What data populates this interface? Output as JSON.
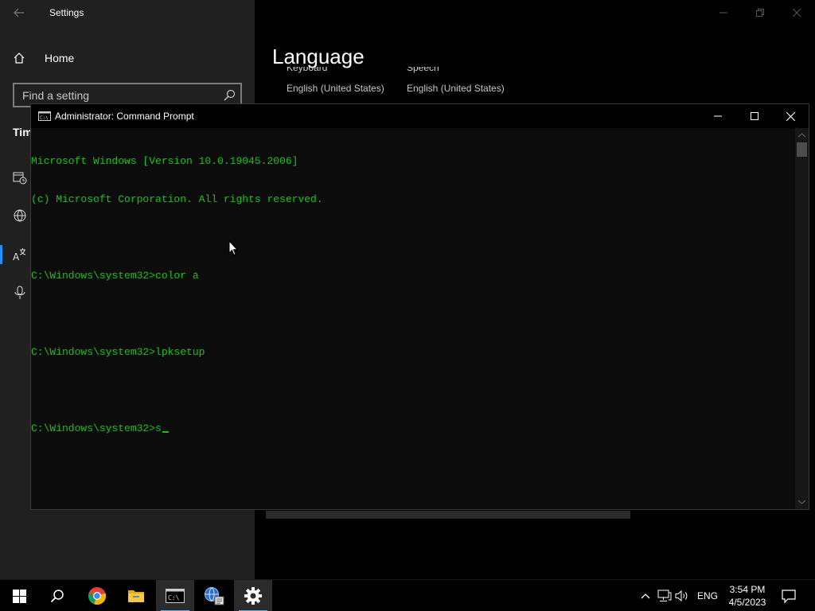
{
  "settings": {
    "window_title": "Settings",
    "home_label": "Home",
    "search_placeholder": "Find a setting",
    "partial_heading": "Tim",
    "page_heading": "Language",
    "columns": [
      {
        "cut_label": "Keyboard",
        "value": "English (United States)"
      },
      {
        "cut_label": "Speech",
        "value": "English (United States)"
      }
    ]
  },
  "cmd": {
    "title": "Administrator: Command Prompt",
    "lines": [
      "Microsoft Windows [Version 10.0.19045.2006]",
      "(c) Microsoft Corporation. All rights reserved.",
      "",
      "C:\\Windows\\system32>color a",
      "",
      "C:\\Windows\\system32>lpksetup",
      "",
      "C:\\Windows\\system32>s"
    ],
    "text_color": "#13c613"
  },
  "taskbar": {
    "apps": [
      "start-icon",
      "search-icon",
      "chrome-icon",
      "file-explorer-icon",
      "command-prompt-icon",
      "network-globe-icon",
      "settings-gear-icon"
    ],
    "active_app": "command-prompt-icon",
    "language": "ENG",
    "time": "3:54 PM",
    "date": "4/5/2023"
  },
  "colors": {
    "accent": "#1e90ff",
    "sidebar_bg": "#202020",
    "console_bg": "#0c0c0c"
  }
}
